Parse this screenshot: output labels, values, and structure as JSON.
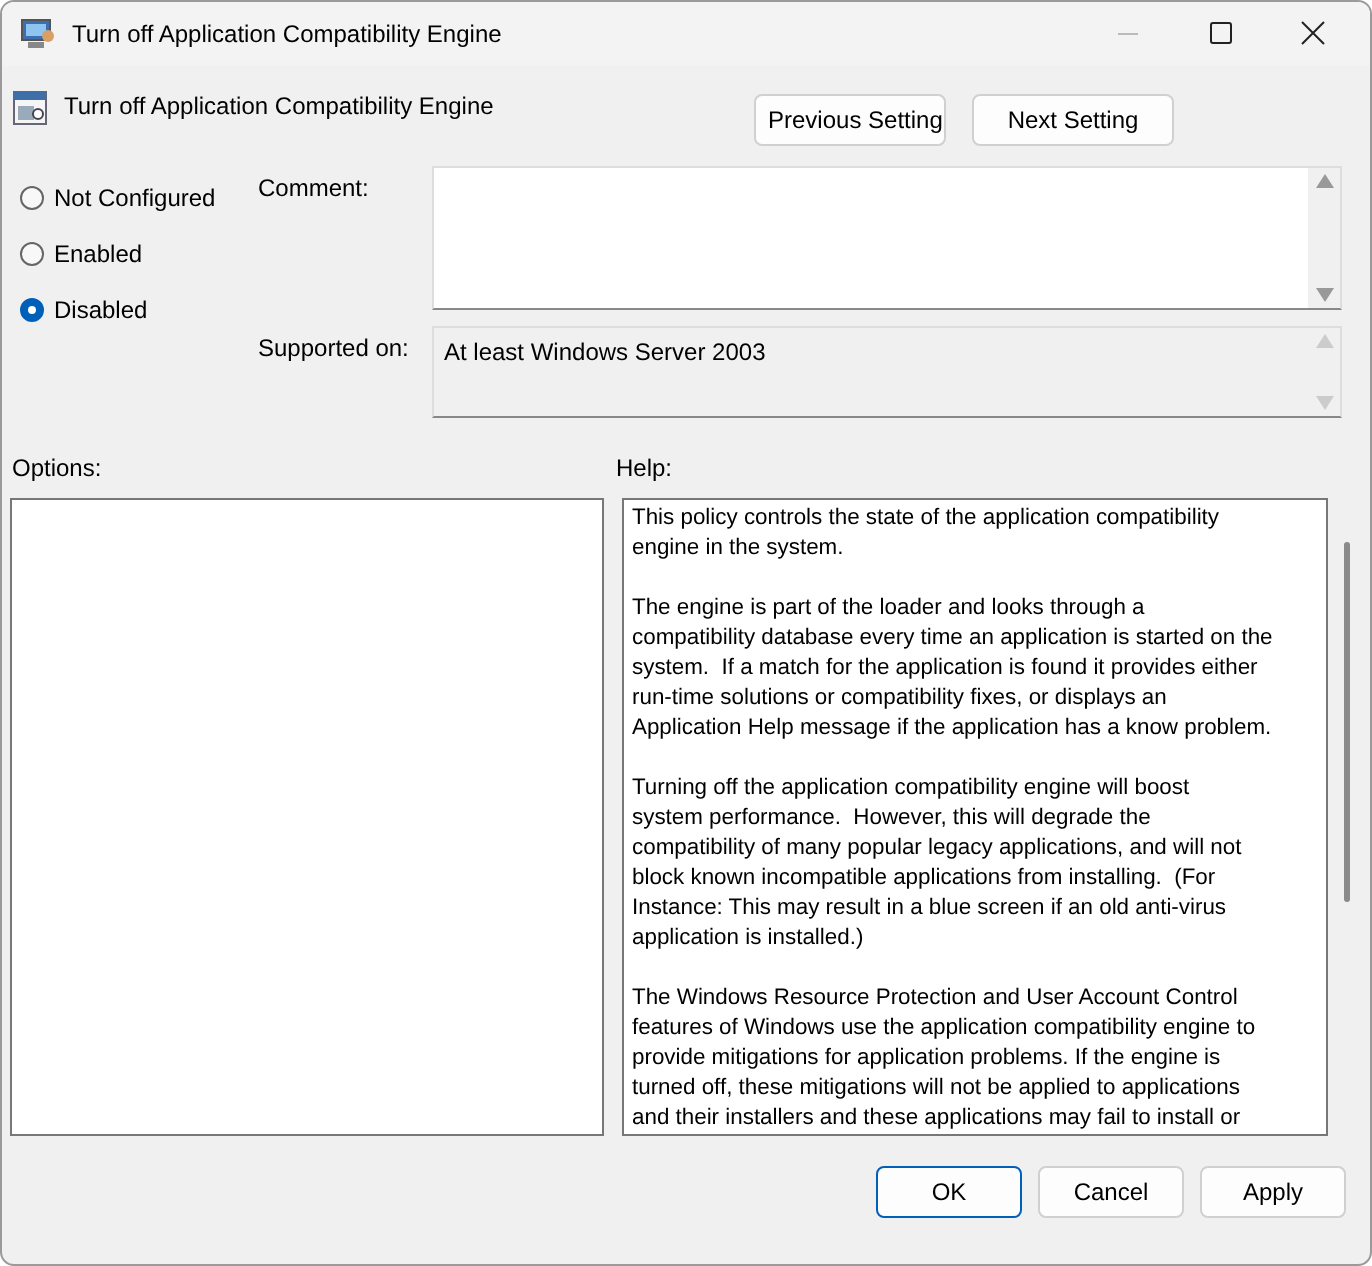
{
  "window": {
    "title": "Turn off Application Compatibility Engine"
  },
  "policy_title": "Turn off Application Compatibility Engine",
  "nav_buttons": [
    "Previous Setting",
    "Next Setting"
  ],
  "state_options": [
    {
      "label": "Not Configured",
      "selected": false
    },
    {
      "label": "Enabled",
      "selected": false
    },
    {
      "label": "Disabled",
      "selected": true
    }
  ],
  "comment": {
    "label": "Comment:"
  },
  "supported_on": {
    "label": "Supported on:",
    "value": "At least Windows Server 2003"
  },
  "options": {
    "label": "Options:"
  },
  "help": {
    "label": "Help:",
    "paragraphs": [
      [
        "This policy controls the state of the application compatibility",
        "engine in the system."
      ],
      [
        "The engine is part of the loader and looks through a",
        "compatibility database every time an application is started on the",
        "system.  If a match for the application is found it provides either",
        "run-time solutions or compatibility fixes, or displays an",
        "Application Help message if the application has a know problem."
      ],
      [
        "Turning off the application compatibility engine will boost",
        "system performance.  However, this will degrade the",
        "compatibility of many popular legacy applications, and will not",
        "block known incompatible applications from installing.  (For",
        "Instance: This may result in a blue screen if an old anti-virus",
        "application is installed.)"
      ],
      [
        "The Windows Resource Protection and User Account Control",
        "features of Windows use the application compatibility engine to",
        "provide mitigations for application problems. If the engine is",
        "turned off, these mitigations will not be applied to applications",
        "and their installers and these applications may fail to install or"
      ]
    ]
  },
  "buttons": [
    {
      "label": "OK",
      "default": true
    },
    {
      "label": "Cancel",
      "default": false
    },
    {
      "label": "Apply",
      "default": false
    }
  ]
}
